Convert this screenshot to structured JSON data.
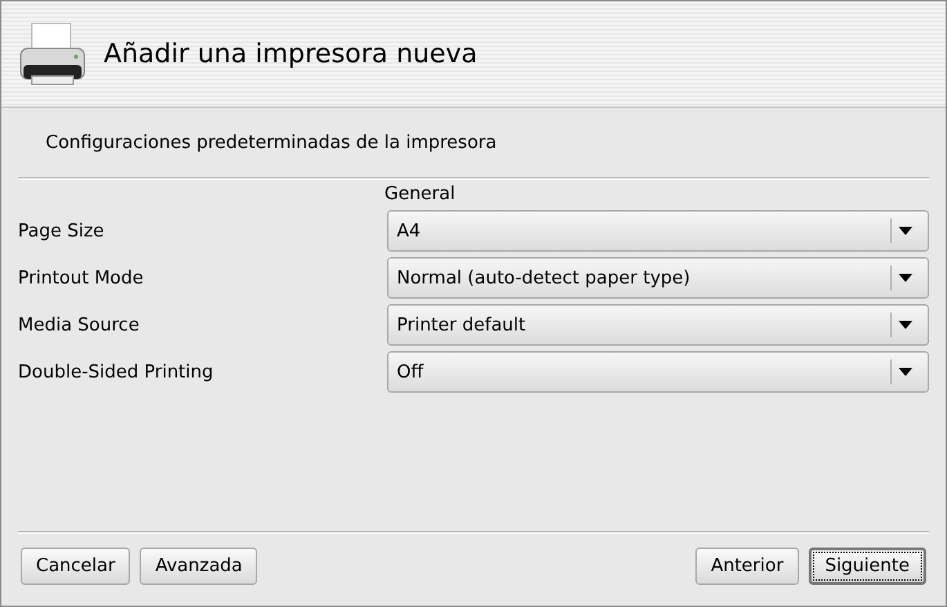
{
  "window": {
    "title": "Añadir una impresora nueva"
  },
  "subtitle": "Configuraciones predeterminadas de la impresora",
  "group": {
    "title": "General"
  },
  "options": [
    {
      "label": "Page Size",
      "value": "A4"
    },
    {
      "label": "Printout Mode",
      "value": "Normal (auto-detect paper type)"
    },
    {
      "label": "Media Source",
      "value": "Printer default"
    },
    {
      "label": "Double-Sided Printing",
      "value": "Off"
    }
  ],
  "buttons_left": [
    {
      "label": "Cancelar",
      "focused": false
    },
    {
      "label": "Avanzada",
      "focused": false
    }
  ],
  "buttons_right": [
    {
      "label": "Anterior",
      "focused": false
    },
    {
      "label": "Siguiente",
      "focused": true
    }
  ]
}
